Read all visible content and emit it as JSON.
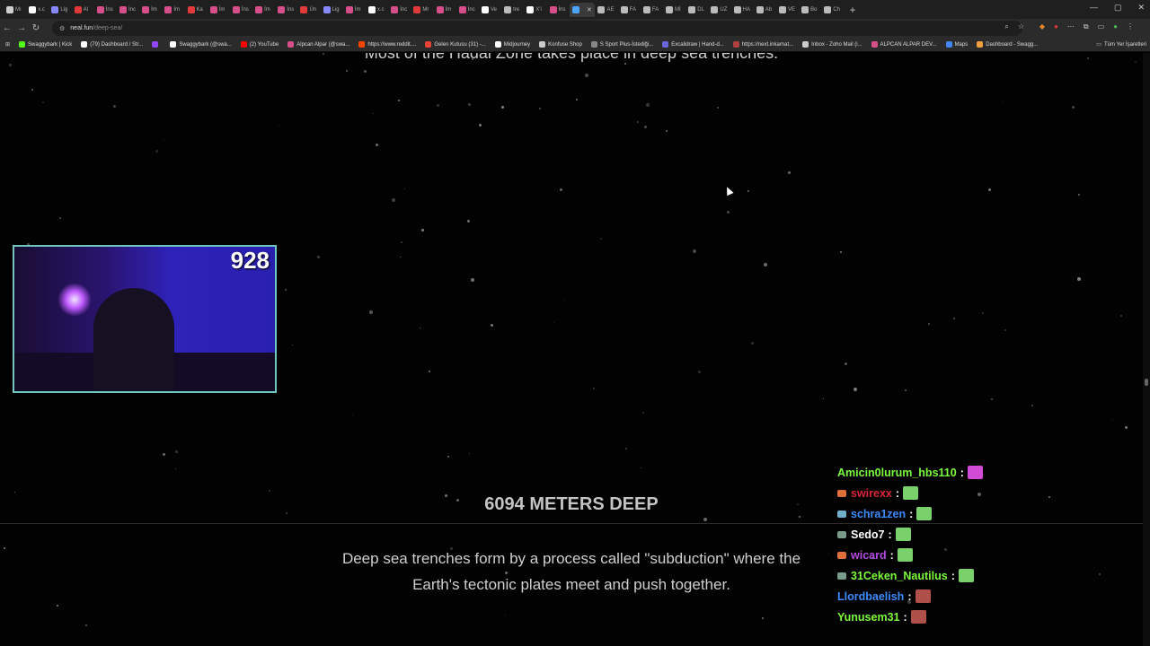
{
  "browser": {
    "tabs": [
      {
        "label": "Mı",
        "color": "#d0d0d0"
      },
      {
        "label": "x.c",
        "color": "#ffffff"
      },
      {
        "label": "Lig",
        "color": "#8888ff"
      },
      {
        "label": "Al",
        "color": "#e03a3a"
      },
      {
        "label": "İns",
        "color": "#d64e8a"
      },
      {
        "label": "İnc",
        "color": "#d64e8a"
      },
      {
        "label": "İm",
        "color": "#d64e8a"
      },
      {
        "label": "İm",
        "color": "#d64e8a"
      },
      {
        "label": "Ka",
        "color": "#e03a3a"
      },
      {
        "label": "İm",
        "color": "#d64e8a"
      },
      {
        "label": "İns",
        "color": "#d64e8a"
      },
      {
        "label": "İm",
        "color": "#d64e8a"
      },
      {
        "label": "İns",
        "color": "#d64e8a"
      },
      {
        "label": "Ün",
        "color": "#e03a3a"
      },
      {
        "label": "Lig",
        "color": "#8888ff"
      },
      {
        "label": "İm",
        "color": "#d64e8a"
      },
      {
        "label": "x.c",
        "color": "#ffffff"
      },
      {
        "label": "İnc",
        "color": "#d64e8a"
      },
      {
        "label": "Mr",
        "color": "#e03a3a"
      },
      {
        "label": "İm",
        "color": "#d64e8a"
      },
      {
        "label": "İnc",
        "color": "#d64e8a"
      },
      {
        "label": "Ve",
        "color": "#ffffff"
      },
      {
        "label": "tre",
        "color": "#bbbbbb"
      },
      {
        "label": "X'i",
        "color": "#ffffff"
      },
      {
        "label": "İns",
        "color": "#d64e8a"
      },
      {
        "label": "",
        "color": "#4da3ff",
        "active": true
      },
      {
        "label": "AE",
        "color": "#bbbbbb"
      },
      {
        "label": "FA",
        "color": "#bbbbbb"
      },
      {
        "label": "FA",
        "color": "#bbbbbb"
      },
      {
        "label": "Mİ",
        "color": "#bbbbbb"
      },
      {
        "label": "DL",
        "color": "#bbbbbb"
      },
      {
        "label": "UZ",
        "color": "#bbbbbb"
      },
      {
        "label": "HA",
        "color": "#bbbbbb"
      },
      {
        "label": "Ab",
        "color": "#bbbbbb"
      },
      {
        "label": "VE",
        "color": "#bbbbbb"
      },
      {
        "label": "Bo",
        "color": "#bbbbbb"
      },
      {
        "label": "Ch",
        "color": "#bbbbbb"
      }
    ],
    "url_host": "neal.fun",
    "url_path": "/deep-sea/",
    "bookmarks": [
      {
        "label": "Swaggybark | Kick",
        "color": "#53fc18"
      },
      {
        "label": "(79) Dashboard / Str...",
        "color": "#ffffff"
      },
      {
        "label": "",
        "color": "#9146ff"
      },
      {
        "label": "Swaggybark (@swa...",
        "color": "#ffffff"
      },
      {
        "label": "(2) YouTube",
        "color": "#ff0000"
      },
      {
        "label": "Alpcan Alpar (@swa...",
        "color": "#d64e8a"
      },
      {
        "label": "https://www.reddit....",
        "color": "#ff4500"
      },
      {
        "label": "Gelen Kutusu (31) -...",
        "color": "#ea4335"
      },
      {
        "label": "Midjourney",
        "color": "#ffffff"
      },
      {
        "label": "Konfuse Shop",
        "color": "#cccccc"
      },
      {
        "label": "S Sport Plus-İstediği...",
        "color": "#888888"
      },
      {
        "label": "Excalidraw | Hand-d...",
        "color": "#6965db"
      },
      {
        "label": "https://next.inkarnat...",
        "color": "#b04040"
      },
      {
        "label": "Inbox - Zoho Mail (i...",
        "color": "#cccccc"
      },
      {
        "label": "ALPCAN ALPAR DEV...",
        "color": "#d64e8a"
      },
      {
        "label": "Maps",
        "color": "#4285f4"
      },
      {
        "label": "Dashboard - Swagg...",
        "color": "#f0a040"
      }
    ],
    "all_bookmarks_label": "Tüm Yer İşaretleri"
  },
  "page": {
    "top_text": "Most of the Hadal Zone takes place in deep sea trenches.",
    "depth_label": "6094 METERS DEEP",
    "description": "Deep sea trenches form by a process called \"subduction\" where the Earth's tectonic plates meet and push together."
  },
  "webcam": {
    "viewer_count": "928"
  },
  "chat": [
    {
      "user": "Amicin0lurum_hbs110",
      "color": "#7cfc3a",
      "badge": "",
      "emote_color": "#d24bd6"
    },
    {
      "user": "swirexx",
      "color": "#d9243a",
      "badge": "#e0703a",
      "emote_color": "#7ad06a"
    },
    {
      "user": "schra1zen",
      "color": "#3d8cff",
      "badge": "#6fb0c8",
      "emote_color": "#7ad06a"
    },
    {
      "user": "Sedo7",
      "color": "#ffffff",
      "badge": "#7a9a8a",
      "emote_color": "#7ad06a"
    },
    {
      "user": "wicard",
      "color": "#b44ae0",
      "badge": "#e0703a",
      "emote_color": "#7ad06a"
    },
    {
      "user": "31Ceken_Nautilus",
      "color": "#7cfc3a",
      "badge": "#7a9a8a",
      "emote_color": "#7ad06a"
    },
    {
      "user": "Llordbaelish",
      "color": "#3d8cff",
      "badge": "",
      "emote_color": "#b0504a"
    },
    {
      "user": "Yunusem31",
      "color": "#7cfc3a",
      "badge": "",
      "emote_color": "#b0504a"
    }
  ]
}
